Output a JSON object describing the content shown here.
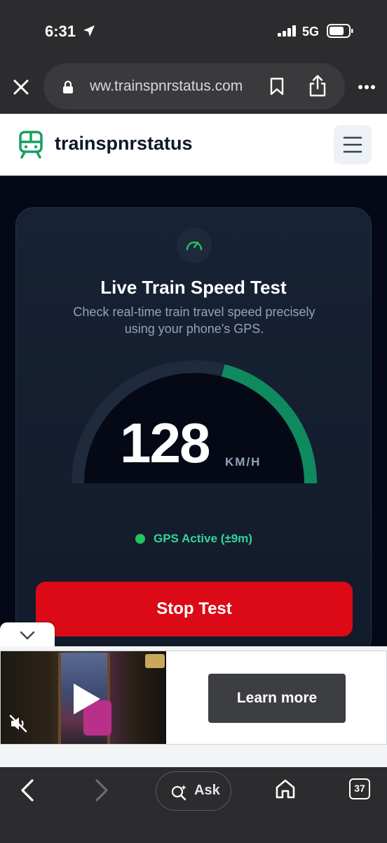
{
  "status_bar": {
    "time": "6:31",
    "network": "5G"
  },
  "browser": {
    "url": "ww.trainspnrstatus.com"
  },
  "site": {
    "name": "trainspnrstatus"
  },
  "speed_card": {
    "title": "Live Train Speed Test",
    "subtitle": "Check real-time train travel speed precisely using your phone's GPS.",
    "speed": "128",
    "unit": "KM/H",
    "gauge_fraction": 0.58,
    "gps_status": "GPS Active (±9m)",
    "stop_button": "Stop Test"
  },
  "ad": {
    "cta": "Learn more"
  },
  "toolbar": {
    "ask_label": "Ask",
    "tab_count": "37"
  },
  "colors": {
    "accent_green": "#0f8a5f",
    "stop_red": "#dc0a17",
    "gps_green": "#22c55e",
    "card_bg": "#172234"
  }
}
